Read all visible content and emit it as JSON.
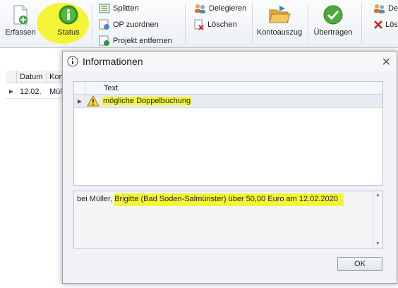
{
  "ribbon": {
    "erfassen": "Erfassen",
    "status": "Status",
    "splitten": "Splitten",
    "op_zuordnen": "OP zuordnen",
    "projekt_entfernen": "Projekt entfernen",
    "delegieren": "Delegieren",
    "loeschen": "Löschen",
    "kontoauszug": "Kontoauszug",
    "uebertragen": "Übertragen",
    "delegieren_cut": "Del",
    "loeschen_cut": "Lös"
  },
  "grid": {
    "columns": [
      "Datum",
      "Kon"
    ],
    "row": {
      "datum": "12.02.",
      "kon": "Müll"
    }
  },
  "dialog": {
    "title": "Informationen",
    "column_header": "Text",
    "rows": [
      {
        "text": "mögliche Doppelbuchung"
      }
    ],
    "memo": {
      "prefix": "bei Müller, ",
      "highlighted": "Brigitte (Bad Soden-Salmünster) über 50,00 Euro am 12.02.2020"
    },
    "ok_label": "OK"
  },
  "colors": {
    "highlight": "#f3f536",
    "accent": "#1f6bb8"
  }
}
